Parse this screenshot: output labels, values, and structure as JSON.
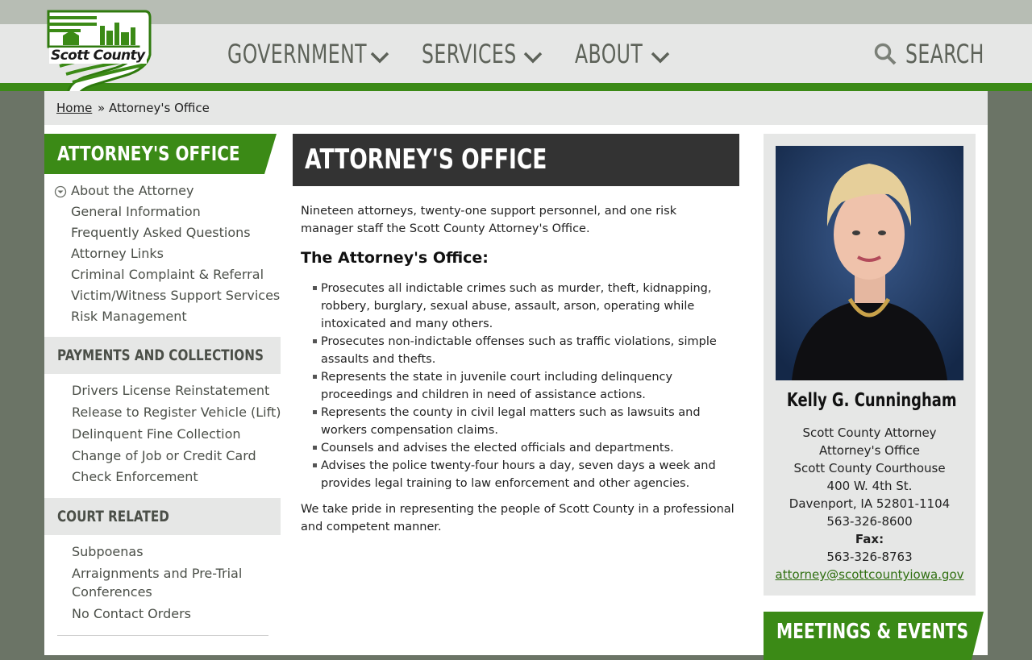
{
  "header": {
    "logo_text": "Scott County",
    "nav": [
      {
        "label": "GOVERNMENT"
      },
      {
        "label": "SERVICES"
      },
      {
        "label": "ABOUT"
      }
    ],
    "search_label": "SEARCH"
  },
  "breadcrumb": {
    "home": "Home",
    "current": "» Attorney's Office"
  },
  "sidebar": {
    "title": "ATTORNEY'S OFFICE",
    "items": [
      {
        "label": "About the Attorney"
      },
      {
        "label": "General Information"
      },
      {
        "label": "Frequently Asked Questions"
      },
      {
        "label": "Attorney Links"
      },
      {
        "label": "Criminal Complaint & Referral"
      },
      {
        "label": "Victim/Witness Support Services"
      },
      {
        "label": "Risk Management"
      }
    ],
    "sections": [
      {
        "title": "PAYMENTS AND COLLECTIONS",
        "items": [
          {
            "label": "Drivers License Reinstatement"
          },
          {
            "label": "Release to Register Vehicle (Lift)"
          },
          {
            "label": "Delinquent Fine Collection"
          },
          {
            "label": "Change of Job or Credit Card"
          },
          {
            "label": "Check Enforcement"
          }
        ]
      },
      {
        "title": "COURT RELATED",
        "items": [
          {
            "label": "Subpoenas"
          },
          {
            "label": "Arraignments and Pre-Trial"
          },
          {
            "label": "Conferences"
          },
          {
            "label": "No Contact Orders"
          }
        ]
      }
    ]
  },
  "main": {
    "title": "ATTORNEY'S OFFICE",
    "intro_line1": "Nineteen attorneys, twenty-one support personnel, and one risk",
    "intro_line2": "manager staff the Scott County Attorney's Office.",
    "subheading": "The Attorney's Office:",
    "bullets": [
      "Prosecutes all indictable crimes such as murder, theft, kidnapping, robbery, burglary, sexual abuse, assault, arson, operating while intoxicated and many others.",
      "Prosecutes non-indictable offenses such as traffic violations, simple assaults and thefts.",
      "Represents the state in juvenile court including delinquency proceedings and children in need of assistance actions.",
      "Represents the county in civil legal matters such as lawsuits and workers compensation claims.",
      "Counsels and advises the elected officials and departments.",
      "Advises the police twenty-four hours a day, seven days a week and provides legal training to law enforcement and other agencies."
    ],
    "closing_line1": "We take pride in representing the people of Scott County in a professional",
    "closing_line2": "and competent manner."
  },
  "contact": {
    "name": "Kelly G. Cunningham",
    "title": "Scott County Attorney",
    "office": "Attorney's Office",
    "building": "Scott County Courthouse",
    "street": "400 W. 4th St.",
    "city": "Davenport, IA 52801-1104",
    "phone": "563-326-8600",
    "fax_label": "Fax:",
    "fax": "563-326-8763",
    "email": "attorney@scottcountyiowa.gov"
  },
  "meetings": {
    "title": "MEETINGS & EVENTS"
  },
  "colors": {
    "brand_green": "#3b8a16",
    "dark_header": "#333333",
    "nav_text": "#5d6259"
  }
}
